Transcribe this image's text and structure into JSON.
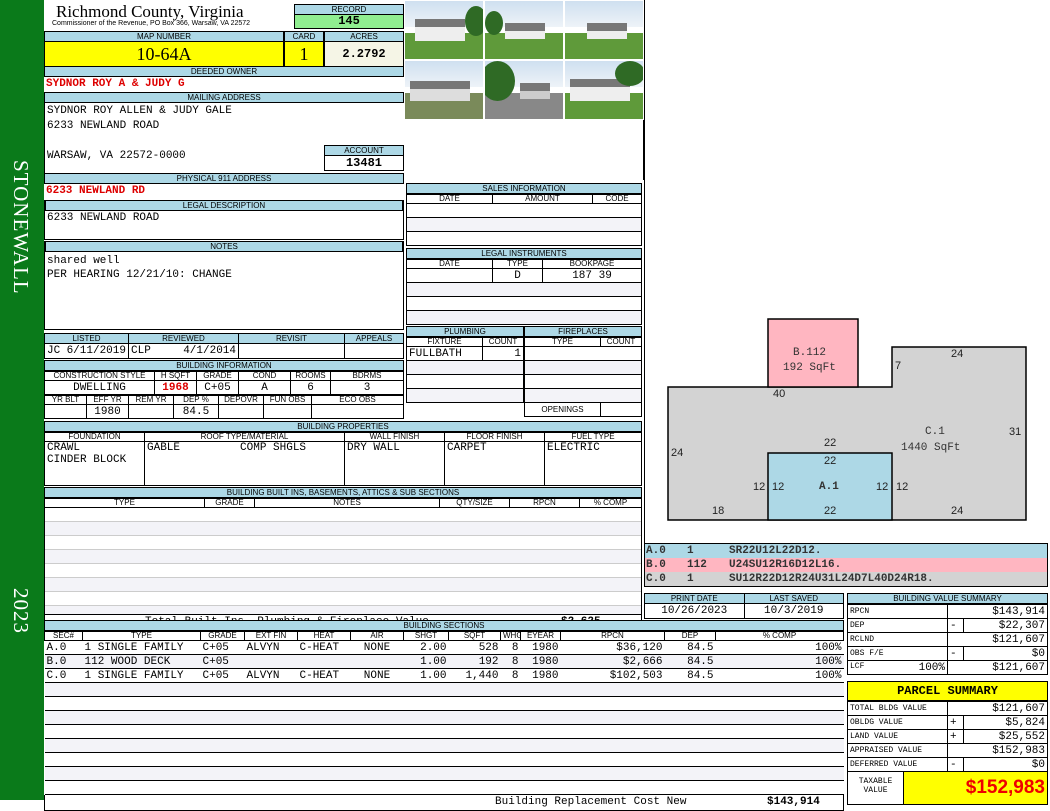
{
  "district": "STONEWALL",
  "year": "2023",
  "header": {
    "title": "Richmond County, Virginia",
    "subtitle": "Commissioner of the Revenue, PO Box 366, Warsaw, VA 22572",
    "record_label": "RECORD",
    "record": "145",
    "map_label": "MAP NUMBER",
    "map_number": "10-64A",
    "card_label": "CARD",
    "card": "1",
    "acres_label": "ACRES",
    "acres": "2.2792"
  },
  "owner": {
    "deeded_label": "DEEDED OWNER",
    "deeded": "SYDNOR ROY A & JUDY G",
    "mailing_label": "MAILING ADDRESS",
    "mailing": [
      "SYDNOR ROY ALLEN & JUDY GALE",
      "6233 NEWLAND ROAD",
      "",
      "WARSAW, VA 22572-0000"
    ],
    "account_label": "ACCOUNT",
    "account": "13481",
    "physical_label": "PHYSICAL 911 ADDRESS",
    "physical": "6233 NEWLAND RD"
  },
  "legal": {
    "label": "LEGAL DESCRIPTION",
    "text": "6233 NEWLAND ROAD"
  },
  "notes": {
    "label": "NOTES",
    "lines": [
      "shared well",
      "PER HEARING 12/21/10: CHANGE"
    ]
  },
  "listing": {
    "listed_label": "LISTED",
    "reviewed_label": "REVIEWED",
    "revisit_label": "REVISIT",
    "appeals_label": "APPEALS",
    "listed_by": "JC",
    "listed_date": "6/11/2019",
    "reviewed_by": "CLP",
    "reviewed_date": "4/1/2014"
  },
  "building_info": {
    "label": "BUILDING INFORMATION",
    "h1": [
      "CONSTRUCTION STYLE",
      "H SQFT",
      "GRADE",
      "COND",
      "ROOMS",
      "BDRMS"
    ],
    "v1": [
      "DWELLING",
      "1968",
      "C+05",
      "A",
      "6",
      "3"
    ],
    "h2": [
      "YR BLT",
      "EFF YR",
      "REM YR",
      "DEP %",
      "DEPOVR",
      "FUN OBS",
      "ECO OBS"
    ],
    "v2": [
      "",
      "1980",
      "",
      "84.5",
      "",
      "",
      ""
    ]
  },
  "building_props": {
    "label": "BUILDING PROPERTIES",
    "headers": [
      "FOUNDATION",
      "ROOF TYPE/MATERIAL",
      "WALL FINISH",
      "FLOOR FINISH",
      "FUEL TYPE"
    ],
    "foundation": [
      "CRAWL",
      "CINDER BLOCK"
    ],
    "roof_type": "GABLE",
    "roof_material": "COMP SHGLS",
    "wall": "DRY WALL",
    "floor": "CARPET",
    "fuel": "ELECTRIC"
  },
  "built_ins": {
    "label": "BUILDING BUILT INS, BASEMENTS, ATTICS & SUB SECTIONS",
    "headers": [
      "TYPE",
      "GRADE",
      "NOTES",
      "QTY/SIZE",
      "RPCN",
      "% COMP"
    ],
    "total_label": "Total Built Ins, Plumbing & Fireplace Value",
    "total": "$2,625"
  },
  "sales": {
    "label": "SALES INFORMATION",
    "headers": [
      "DATE",
      "AMOUNT",
      "CODE"
    ]
  },
  "legal_instruments": {
    "label": "LEGAL INSTRUMENTS",
    "headers": [
      "DATE",
      "TYPE",
      "BOOKPAGE"
    ],
    "rows": [
      {
        "date": "",
        "type": "D",
        "bookpage": "187 39"
      }
    ]
  },
  "plumbing": {
    "label": "PLUMBING",
    "headers": [
      "FIXTURE",
      "COUNT"
    ],
    "rows": [
      {
        "fixture": "FULLBATH",
        "count": "1"
      }
    ]
  },
  "fireplaces": {
    "label": "FIREPLACES",
    "headers": [
      "TYPE",
      "COUNT"
    ],
    "openings_label": "OPENINGS"
  },
  "sketch": {
    "b_label": "B.112",
    "b_area": "192 SqFt",
    "c_label": "C.1",
    "c_area": "1440 SqFt",
    "a_label": "A.1",
    "dims": [
      "24",
      "7",
      "40",
      "22",
      "31",
      "24",
      "22",
      "12",
      "12",
      "12",
      "12",
      "18",
      "22",
      "24"
    ]
  },
  "sketch_codes": [
    {
      "sec": "A.0",
      "code": "1",
      "path": "SR22U12L22D12.",
      "color": "#add8e6"
    },
    {
      "sec": "B.0",
      "code": "112",
      "path": "U24SU12R16D12L16.",
      "color": "#ffb6c1"
    },
    {
      "sec": "C.0",
      "code": "1",
      "path": "SU12R22D12R24U31L24D7L40D24R18.",
      "color": "#d3d3d3"
    }
  ],
  "dates": {
    "print_label": "PRINT DATE",
    "print": "10/26/2023",
    "saved_label": "LAST SAVED",
    "saved": "10/3/2019"
  },
  "building_sections": {
    "label": "BUILDING SECTIONS",
    "headers": [
      "SEC#",
      "TYPE",
      "GRADE",
      "EXT FIN",
      "HEAT",
      "AIR",
      "SHGT",
      "SQFT",
      "WHGT",
      "EYEAR",
      "RPCN",
      "DEP",
      "% COMP"
    ],
    "rows": [
      {
        "sec": "A.0",
        "type": "1 SINGLE FAMILY",
        "grade": "C+05",
        "ext": "ALVYN",
        "heat": "C-HEAT",
        "air": "NONE",
        "shgt": "2.00",
        "sqft": "528",
        "whgt": "8",
        "eyear": "1980",
        "rpcn": "$36,120",
        "dep": "84.5",
        "comp": "100%"
      },
      {
        "sec": "B.0",
        "type": "112 WOOD DECK",
        "grade": "C+05",
        "ext": "",
        "heat": "",
        "air": "",
        "shgt": "1.00",
        "sqft": "192",
        "whgt": "8",
        "eyear": "1980",
        "rpcn": "$2,666",
        "dep": "84.5",
        "comp": "100%"
      },
      {
        "sec": "C.0",
        "type": "1 SINGLE FAMILY",
        "grade": "C+05",
        "ext": "ALVYN",
        "heat": "C-HEAT",
        "air": "NONE",
        "shgt": "1.00",
        "sqft": "1,440",
        "whgt": "8",
        "eyear": "1980",
        "rpcn": "$102,503",
        "dep": "84.5",
        "comp": "100%"
      }
    ],
    "total_label": "Building Replacement Cost New",
    "total": "$143,914"
  },
  "value_summary": {
    "label": "BUILDING VALUE SUMMARY",
    "rpcn_label": "RPCN",
    "rpcn": "$143,914",
    "dep_label": "DEP",
    "dep_sign": "-",
    "dep": "$22,307",
    "rclnd_label": "RCLND",
    "rclnd": "$121,607",
    "obs_label": "OBS F/E",
    "obs_sign": "-",
    "obs": "$0",
    "lcf_label": "LCF",
    "lcf_pct": "100%",
    "lcf": "$121,607"
  },
  "parcel": {
    "label": "PARCEL SUMMARY",
    "total_bldg_label": "TOTAL BLDG VALUE",
    "total_bldg": "$121,607",
    "obldg_label": "OBLDG VALUE",
    "obldg_sign": "+",
    "obldg": "$5,824",
    "land_label": "LAND VALUE",
    "land_sign": "+",
    "land": "$25,552",
    "appraised_label": "APPRAISED VALUE",
    "appraised": "$152,983",
    "deferred_label": "DEFERRED VALUE",
    "deferred_sign": "-",
    "deferred": "$0",
    "taxable_label": "TAXABLE VALUE",
    "taxable": "$152,983"
  }
}
